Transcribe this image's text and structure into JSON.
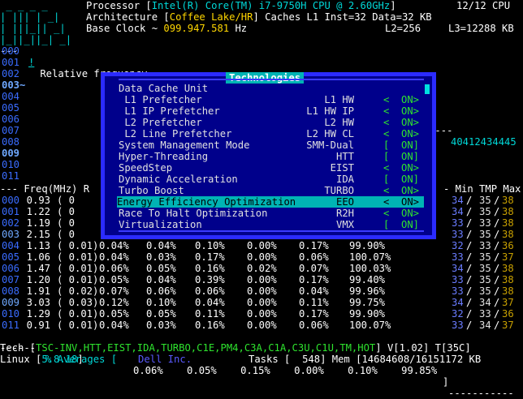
{
  "header": {
    "dashes": " _ _ _ _",
    "processor_label": "Processor [",
    "processor_name": "Intel(R) Core(TM) i7-9750H CPU @ 2.60GHz",
    "processor_close": "]",
    "cpu_count": "12/12",
    "cpu_unit": "CPU",
    "bars1": "| ||| | _|",
    "arch_label": "Architecture [",
    "arch_name": "Coffee Lake/HR",
    "caches_label": "] Caches L1 Inst=",
    "l1_inst": "32",
    "data_label": "Data=",
    "l1_data": "32",
    "cache_unit": "KB",
    "bars2": "| |||_|| _|",
    "base_clock_label": "Base Clock ~",
    "base_clock_value": "099.947.581",
    "base_clock_unit": "Hz",
    "l2_label": "L2=",
    "l2_value": "256",
    "l3_label": "L3=",
    "l3_value": "12288",
    "l3_unit": "KB",
    "bars3": "|_||_||_| _|",
    "rel_freq_prefix": "--- ",
    "rel_freq_marker": "!",
    "rel_freq_label": " Relative frequency ",
    "rel_freq_mid1": "22",
    "rel_freq_mid2": "226",
    "rel_freq_end": "40412434445"
  },
  "cores_top": [
    "000",
    "001",
    "002",
    "003~",
    "004",
    "005",
    "006",
    "007",
    "008",
    "009",
    "010",
    "011"
  ],
  "popup": {
    "title": "Technologies",
    "items": [
      {
        "label": "Data Cache Unit",
        "code": "",
        "value": ""
      },
      {
        "label": " L1 Prefetcher",
        "code": "L1 HW",
        "value": "<  ON>"
      },
      {
        "label": " L1 IP Prefetcher",
        "code": "L1 HW IP",
        "value": "<  ON>"
      },
      {
        "label": " L2 Prefetcher",
        "code": "L2 HW",
        "value": "<  ON>"
      },
      {
        "label": " L2 Line Prefetcher",
        "code": "L2 HW CL",
        "value": "<  ON>"
      },
      {
        "label": "System Management Mode",
        "code": "SMM-Dual",
        "value": "[  ON]"
      },
      {
        "label": "Hyper-Threading",
        "code": "HTT",
        "value": "[  ON]"
      },
      {
        "label": "SpeedStep",
        "code": "EIST",
        "value": "<  ON>"
      },
      {
        "label": "Dynamic Acceleration",
        "code": "IDA",
        "value": "[  ON]"
      },
      {
        "label": "Turbo Boost",
        "code": "TURBO",
        "value": "<  ON>"
      },
      {
        "label": "Energy Efficiency Optimization",
        "code": "EEO",
        "value": "<  ON>",
        "selected": true
      },
      {
        "label": "Race To Halt Optimization",
        "code": "R2H",
        "value": "<  ON>"
      },
      {
        "label": "Virtualization",
        "code": "VMX",
        "value": "[  ON]"
      }
    ]
  },
  "table": {
    "header_left": "--- Freq(MHz) R",
    "header_right": "- Min TMP Max",
    "rows": [
      {
        "core": "000",
        "freq": "0.93",
        "ratio": "( 0",
        "c1": "",
        "c2": "",
        "c3": "",
        "c4": "",
        "c5": "",
        "c6": "",
        "t1": "34",
        "t2": "35",
        "t3": "38"
      },
      {
        "core": "001",
        "freq": "1.22",
        "ratio": "( 0",
        "c1": "",
        "c2": "",
        "c3": "",
        "c4": "",
        "c5": "",
        "c6": "",
        "t1": "34",
        "t2": "35",
        "t3": "38"
      },
      {
        "core": "002",
        "freq": "1.19",
        "ratio": "( 0",
        "c1": "",
        "c2": "",
        "c3": "",
        "c4": "",
        "c5": "",
        "c6": "",
        "t1": "33",
        "t2": "33",
        "t3": "38"
      },
      {
        "core": "003",
        "freq": "2.15",
        "ratio": "( 0",
        "c1": "",
        "c2": "",
        "c3": "",
        "c4": "",
        "c5": "",
        "c6": "",
        "t1": "33",
        "t2": "35",
        "t3": "38"
      },
      {
        "core": "004",
        "freq": "1.13",
        "ratio": "( 0.01)",
        "c1": "0.04%",
        "c2": "0.04%",
        "c3": "0.10%",
        "c4": "0.00%",
        "c5": "0.17%",
        "c6": "99.90%",
        "t1": "32",
        "t2": "33",
        "t3": "36"
      },
      {
        "core": "005",
        "freq": "1.06",
        "ratio": "( 0.01)",
        "c1": "0.04%",
        "c2": "0.03%",
        "c3": "0.17%",
        "c4": "0.00%",
        "c5": "0.06%",
        "c6": "100.07%",
        "t1": "33",
        "t2": "35",
        "t3": "37"
      },
      {
        "core": "006",
        "freq": "1.47",
        "ratio": "( 0.01)",
        "c1": "0.06%",
        "c2": "0.05%",
        "c3": "0.16%",
        "c4": "0.02%",
        "c5": "0.07%",
        "c6": "100.03%",
        "t1": "34",
        "t2": "35",
        "t3": "38"
      },
      {
        "core": "007",
        "freq": "1.20",
        "ratio": "( 0.01)",
        "c1": "0.05%",
        "c2": "0.04%",
        "c3": "0.39%",
        "c4": "0.00%",
        "c5": "0.17%",
        "c6": "99.40%",
        "t1": "33",
        "t2": "35",
        "t3": "38"
      },
      {
        "core": "008",
        "freq": "1.91",
        "ratio": "( 0.02)",
        "c1": "0.07%",
        "c2": "0.06%",
        "c3": "0.06%",
        "c4": "0.00%",
        "c5": "0.04%",
        "c6": "99.96%",
        "t1": "33",
        "t2": "35",
        "t3": "38"
      },
      {
        "core": "009",
        "freq": "3.03",
        "ratio": "( 0.03)",
        "c1": "0.12%",
        "c2": "0.10%",
        "c3": "0.04%",
        "c4": "0.00%",
        "c5": "0.11%",
        "c6": "99.75%",
        "t1": "34",
        "t2": "34",
        "t3": "37"
      },
      {
        "core": "010",
        "freq": "1.29",
        "ratio": "( 0.01)",
        "c1": "0.05%",
        "c2": "0.05%",
        "c3": "0.11%",
        "c4": "0.00%",
        "c5": "0.17%",
        "c6": "99.90%",
        "t1": "32",
        "t2": "33",
        "t3": "36"
      },
      {
        "core": "011",
        "freq": "0.91",
        "ratio": "( 0.01)",
        "c1": "0.04%",
        "c2": "0.03%",
        "c3": "0.16%",
        "c4": "0.00%",
        "c5": "0.06%",
        "c6": "100.07%",
        "t1": "33",
        "t2": "34",
        "t3": "37"
      }
    ],
    "avg_label": "% Averages [",
    "avg_values": "0.06%    0.05%    0.15%    0.00%    0.10%    99.85%",
    "avg_close": "]"
  },
  "footer": {
    "tech_label": "Tech [",
    "tech_list": "TSC-INV,HTT,EIST,IDA,TURBO,C1E,PM4,C3A,C1A,C3U,C1U,TM,HOT",
    "tech_close": "] V[",
    "voltage": "1.02",
    "temp_label": "] T[",
    "temp": "35C",
    "linux_label": "Linux [",
    "linux_version": "5.8.18",
    "vendor": "Dell Inc.",
    "tasks_label": "Tasks [",
    "tasks": "548",
    "mem_label": "] Mem [",
    "mem": "14684608/16151172",
    "mem_unit": "KB"
  }
}
